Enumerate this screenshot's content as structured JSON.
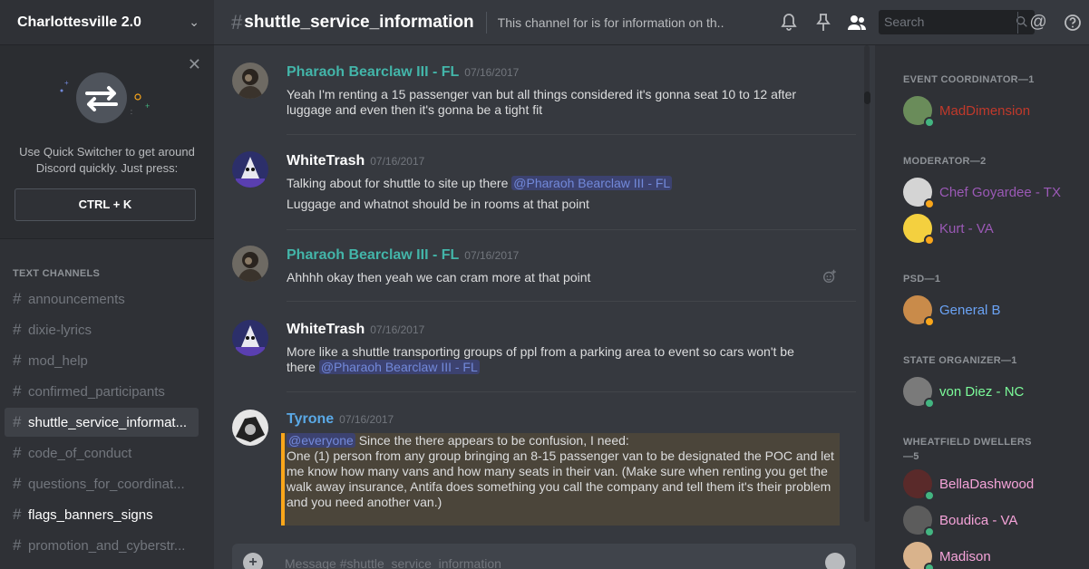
{
  "server": {
    "name": "Charlottesville 2.0"
  },
  "quick_switcher": {
    "text_line1": "Use Quick Switcher to get around",
    "text_line2": "Discord quickly. Just press:",
    "shortcut": "CTRL + K"
  },
  "channels": {
    "category": "TEXT CHANNELS",
    "items": [
      {
        "label": "announcements",
        "state": "normal"
      },
      {
        "label": "dixie-lyrics",
        "state": "normal"
      },
      {
        "label": "mod_help",
        "state": "normal"
      },
      {
        "label": "confirmed_participants",
        "state": "normal"
      },
      {
        "label": "shuttle_service_informat...",
        "state": "active"
      },
      {
        "label": "code_of_conduct",
        "state": "normal"
      },
      {
        "label": "questions_for_coordinat...",
        "state": "normal"
      },
      {
        "label": "flags_banners_signs",
        "state": "unread"
      },
      {
        "label": "promotion_and_cyberstr...",
        "state": "normal"
      }
    ]
  },
  "header": {
    "channel": "shuttle_service_information",
    "topic": "This channel for is for information on th...",
    "search_placeholder": "Search"
  },
  "messages": [
    {
      "author": "Pharaoh Bearclaw III - FL",
      "author_color": "#43b5a9",
      "timestamp": "07/16/2017",
      "line1": "Yeah I'm renting a 15 passenger van but all things considered it's gonna seat 10 to 12 after",
      "line2": "luggage and even then it's gonna be a tight fit"
    },
    {
      "author": "WhiteTrash",
      "author_color": "#ffffff",
      "timestamp": "07/16/2017",
      "line1": "Talking about for shuttle to site up there ",
      "mention": "@Pharaoh Bearclaw III - FL",
      "line2": "Luggage and whatnot should be in rooms at that point"
    },
    {
      "author": "Pharaoh Bearclaw III - FL",
      "author_color": "#43b5a9",
      "timestamp": "07/16/2017",
      "line1": "Ahhhh okay then yeah we can cram more at that point"
    },
    {
      "author": "WhiteTrash",
      "author_color": "#ffffff",
      "timestamp": "07/16/2017",
      "line1": "More like a shuttle transporting groups of ppl from a parking area to event so cars won't be",
      "line2": "there ",
      "mention": "@Pharaoh Bearclaw III - FL"
    },
    {
      "author": "Tyrone",
      "author_color": "#5aa9e6",
      "timestamp": "07/16/2017",
      "mention": "@everyone",
      "line1": " Since the there appears to be confusion, I need:",
      "line2": "One (1) person from any group bringing an 8-15 passenger van to be designated the POC and let",
      "line3": "me know how many vans and how many seats in their van. (Make sure when renting you get the",
      "line4": "walk away insurance, Antifa does something you call the company and tell them it's their problem",
      "line5": "and you need another van.)"
    }
  ],
  "input": {
    "placeholder": "Message #shuttle_service_information"
  },
  "members": {
    "groups": [
      {
        "title": "EVENT COORDINATOR—1",
        "members": [
          {
            "name": "MadDimension",
            "color": "#c0392b",
            "status": "online"
          }
        ]
      },
      {
        "title": "MODERATOR—2",
        "members": [
          {
            "name": "Chef Goyardee - TX",
            "color": "#9b59b6",
            "status": "idle"
          },
          {
            "name": "Kurt - VA",
            "color": "#9b59b6",
            "status": "idle"
          }
        ]
      },
      {
        "title": "PSD—1",
        "members": [
          {
            "name": "General B",
            "color": "#6ba3f5",
            "status": "idle"
          }
        ]
      },
      {
        "title": "STATE ORGANIZER—1",
        "members": [
          {
            "name": "von Diez - NC",
            "color": "#7cfc9a",
            "status": "online"
          }
        ]
      },
      {
        "title": "WHEATFIELD DWELLERS—5",
        "members": [
          {
            "name": "BellaDashwood",
            "color": "#f5a3d9",
            "status": "online"
          },
          {
            "name": "Boudica - VA",
            "color": "#f5a3d9",
            "status": "online"
          },
          {
            "name": "Madison",
            "color": "#f5a3d9",
            "status": "online"
          }
        ]
      }
    ]
  },
  "colors": {
    "online": "#43b581",
    "idle": "#faa61a",
    "mention_bg": "#3c4270",
    "highlight_border": "#faa61a"
  }
}
